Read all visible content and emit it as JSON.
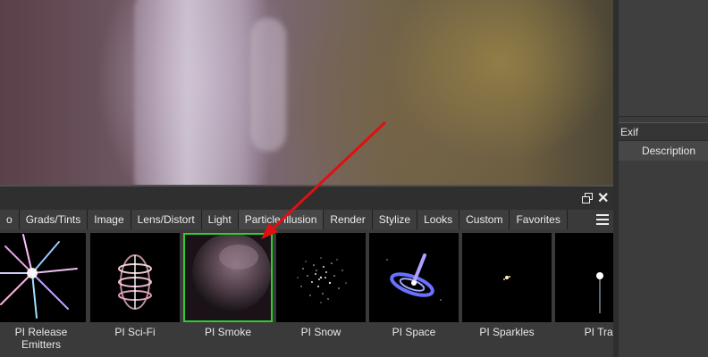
{
  "exif_panel": {
    "header": "Exif",
    "column": "Description"
  },
  "tabs": [
    {
      "label": "o",
      "active": false
    },
    {
      "label": "Grads/Tints",
      "active": false
    },
    {
      "label": "Image",
      "active": false
    },
    {
      "label": "Lens/Distort",
      "active": false
    },
    {
      "label": "Light",
      "active": false
    },
    {
      "label": "Particle Illusion",
      "active": true
    },
    {
      "label": "Render",
      "active": false
    },
    {
      "label": "Stylize",
      "active": false
    },
    {
      "label": "Looks",
      "active": false
    },
    {
      "label": "Custom",
      "active": false
    },
    {
      "label": "Favorites",
      "active": false
    }
  ],
  "thumbnails": [
    {
      "label": "PI Release Emitters",
      "selected": false
    },
    {
      "label": "PI Sci-Fi",
      "selected": false
    },
    {
      "label": "PI Smoke",
      "selected": true
    },
    {
      "label": "PI Snow",
      "selected": false
    },
    {
      "label": "PI Space",
      "selected": false
    },
    {
      "label": "PI Sparkles",
      "selected": false
    },
    {
      "label": "PI Trai",
      "selected": false
    }
  ],
  "colors": {
    "selection_border": "#2ecc2e",
    "annotation_arrow": "#e01010"
  }
}
